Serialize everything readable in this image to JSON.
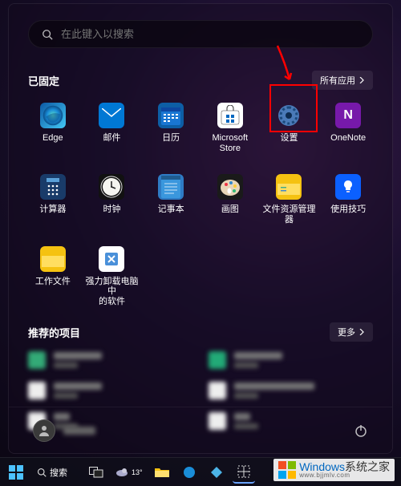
{
  "search": {
    "placeholder": "在此键入以搜索"
  },
  "pinned": {
    "title": "已固定",
    "all_apps_label": "所有应用",
    "apps": [
      {
        "name": "Edge",
        "icon": "edge-icon"
      },
      {
        "name": "邮件",
        "icon": "mail-icon"
      },
      {
        "name": "日历",
        "icon": "calendar-icon"
      },
      {
        "name": "Microsoft Store",
        "icon": "store-icon"
      },
      {
        "name": "设置",
        "icon": "settings-icon"
      },
      {
        "name": "OneNote",
        "icon": "onenote-icon"
      },
      {
        "name": "计算器",
        "icon": "calculator-icon"
      },
      {
        "name": "时钟",
        "icon": "clock-icon"
      },
      {
        "name": "记事本",
        "icon": "notepad-icon"
      },
      {
        "name": "画图",
        "icon": "paint-icon"
      },
      {
        "name": "文件资源管理器",
        "icon": "explorer-icon"
      },
      {
        "name": "使用技巧",
        "icon": "tips-icon"
      },
      {
        "name": "工作文件",
        "icon": "folder-icon"
      },
      {
        "name": "强力卸载电脑中\n的软件",
        "icon": "uninstall-icon"
      }
    ]
  },
  "recommended": {
    "title": "推荐的项目",
    "more_label": "更多",
    "items_count": 6
  },
  "taskbar": {
    "search_label": "搜索",
    "weather_temp": "13°"
  },
  "watermark": {
    "brand": "Windows",
    "suffix": "系统之家",
    "url": "www.bjjmlv.com"
  },
  "annotation": {
    "arrow_color": "#ff0000",
    "highlight_color": "#ff0000",
    "highlighted_app_index": 4
  }
}
